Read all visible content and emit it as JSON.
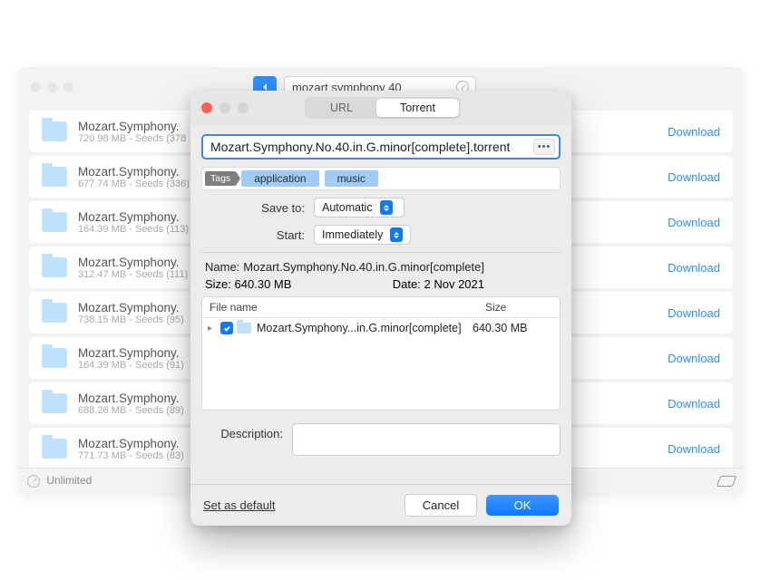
{
  "bg": {
    "search_value": "mozart symphony 40",
    "download_label": "Download",
    "status_label": "Unlimited",
    "results": [
      {
        "title": "Mozart.Symphony.",
        "sub": "720.98 MB - Seeds (378"
      },
      {
        "title": "Mozart.Symphony.",
        "sub": "677.74 MB - Seeds (336)"
      },
      {
        "title": "Mozart.Symphony.",
        "sub": "164.39 MB - Seeds (113)"
      },
      {
        "title": "Mozart.Symphony.",
        "sub": "312.47 MB - Seeds (111)"
      },
      {
        "title": "Mozart.Symphony.",
        "sub": "738.15 MB - Seeds (95)"
      },
      {
        "title": "Mozart.Symphony.",
        "sub": "164.39 MB - Seeds (91)"
      },
      {
        "title": "Mozart.Symphony.",
        "sub": "688.26 MB - Seeds (89)"
      },
      {
        "title": "Mozart.Symphony.",
        "sub": "771.73 MB - Seeds (83)"
      }
    ]
  },
  "dialog": {
    "tabs": {
      "url": "URL",
      "torrent": "Torrent"
    },
    "url_value": "Mozart.Symphony.No.40.in.G.minor[complete].torrent",
    "tags_label": "Tags",
    "tags": [
      "application",
      "music"
    ],
    "save_to_label": "Save to:",
    "save_to_value": "Automatic",
    "start_label": "Start:",
    "start_value": "Immediately",
    "name_label": "Name:",
    "name_value": "Mozart.Symphony.No.40.in.G.minor[complete]",
    "size_label": "Size:",
    "size_value": "640.30 MB",
    "date_label": "Date:",
    "date_value": "2 Nov 2021",
    "col_file": "File name",
    "col_size": "Size",
    "file_name": "Mozart.Symphony...in.G.minor[complete]",
    "file_size": "640.30 MB",
    "description_label": "Description:",
    "set_default": "Set as default",
    "cancel": "Cancel",
    "ok": "OK"
  }
}
